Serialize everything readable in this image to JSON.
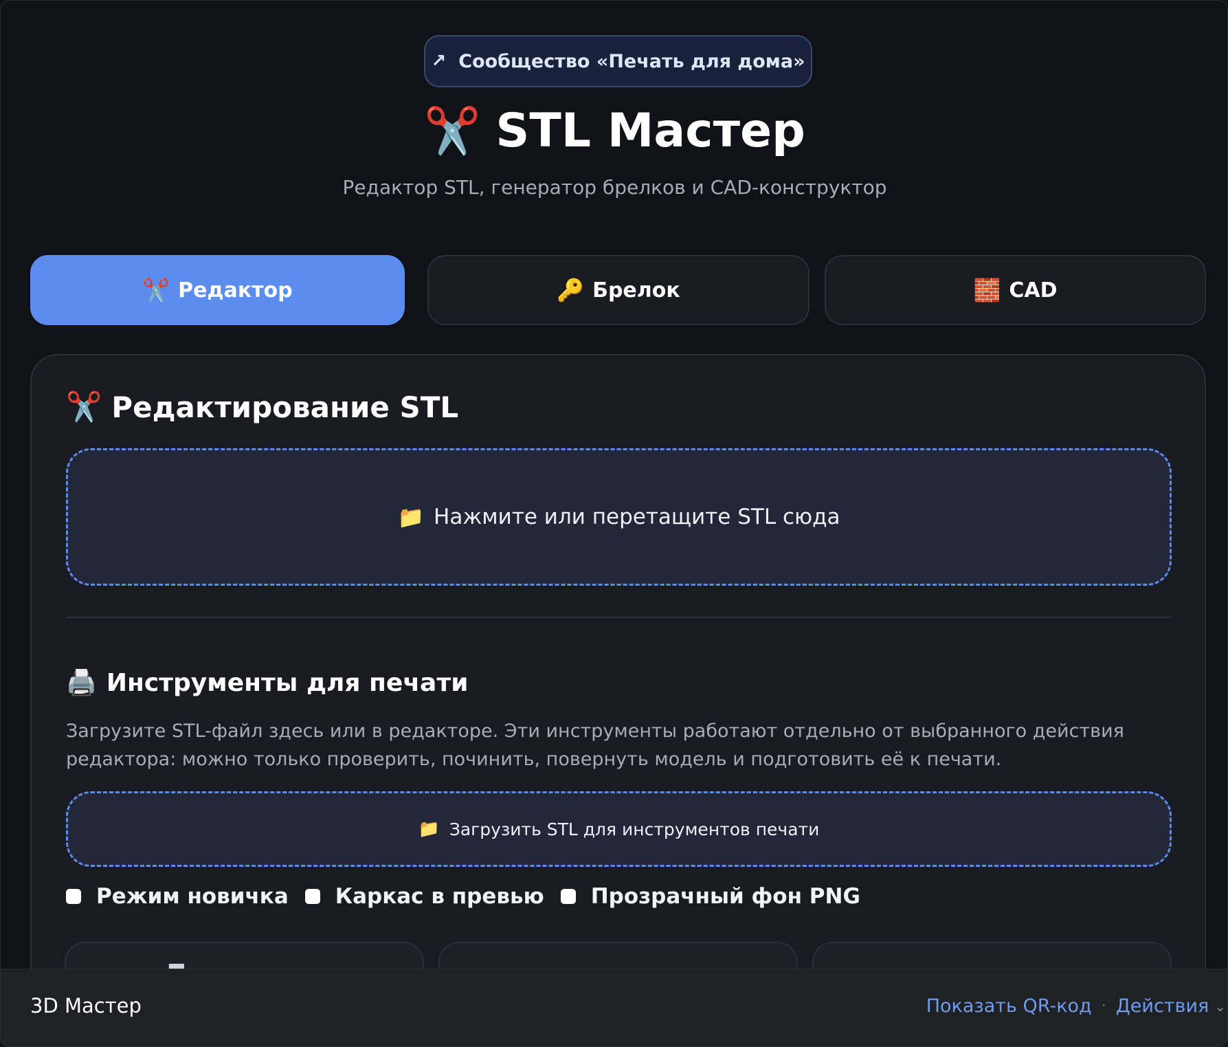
{
  "community_button": {
    "arrow": "↗",
    "label": "Сообщество «Печать для дома»"
  },
  "header": {
    "icon": "✂️",
    "title": "STL Мастер",
    "subtitle": "Редактор STL, генератор брелков и CAD-конструктор"
  },
  "tabs": [
    {
      "icon": "✂️",
      "label": "Редактор",
      "active": true
    },
    {
      "icon": "🔑",
      "label": "Брелок",
      "active": false
    },
    {
      "icon": "🧱",
      "label": "CAD",
      "active": false
    }
  ],
  "editor": {
    "icon": "✂️",
    "title": "Редактирование STL",
    "dropzone_icon": "📁",
    "dropzone_label": "Нажмите или перетащите STL сюда"
  },
  "print_tools": {
    "icon": "🖨️",
    "title": "Инструменты для печати",
    "description": "Загрузите STL-файл здесь или в редакторе. Эти инструменты работают отдельно от выбранного действия редактора: можно только проверить, починить, повернуть модель и подготовить её к печати.",
    "upload_icon": "📁",
    "upload_label": "Загрузить STL для инструментов печати",
    "options": [
      {
        "label": "Режим новичка",
        "checked": false
      },
      {
        "label": "Каркас в превью",
        "checked": false
      },
      {
        "label": "Прозрачный фон PNG",
        "checked": false
      }
    ]
  },
  "bottom_bar": {
    "app_name": "3D Мастер",
    "qr_link": "Показать QR-код",
    "separator": "·",
    "actions_link": "Действия",
    "chevron": "⌄"
  },
  "colors": {
    "accent": "#5b8def",
    "background": "#111217",
    "card": "#1a1b22",
    "link": "#6f9bf0"
  }
}
